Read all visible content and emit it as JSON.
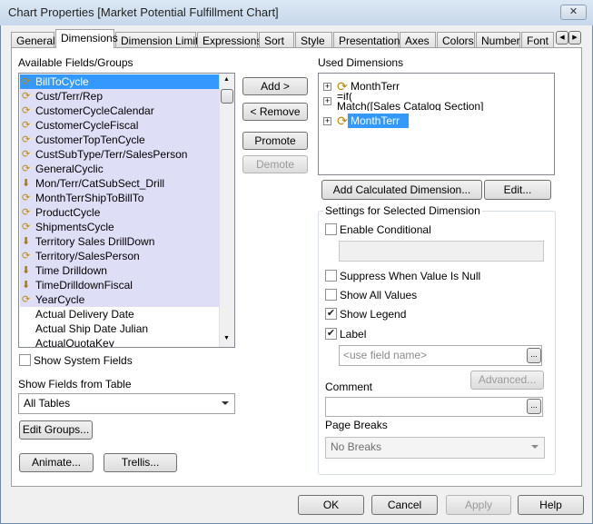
{
  "window": {
    "title": "Chart Properties [Market Potential Fulfillment Chart]",
    "close_icon": "close-icon"
  },
  "tabs": [
    "General",
    "Dimensions",
    "Dimension Limits",
    "Expressions",
    "Sort",
    "Style",
    "Presentation",
    "Axes",
    "Colors",
    "Number",
    "Font"
  ],
  "active_tab": "Dimensions",
  "available": {
    "label": "Available Fields/Groups",
    "items": [
      {
        "label": "BillToCycle",
        "icon": "cyclic-group-icon",
        "selected": true
      },
      {
        "label": "Cust/Terr/Rep",
        "icon": "cyclic-group-icon"
      },
      {
        "label": "CustomerCycleCalendar",
        "icon": "cyclic-group-icon"
      },
      {
        "label": "CustomerCycleFiscal",
        "icon": "cyclic-group-icon"
      },
      {
        "label": "CustomerTopTenCycle",
        "icon": "cyclic-group-icon"
      },
      {
        "label": "CustSubType/Terr/SalesPerson",
        "icon": "cyclic-group-icon"
      },
      {
        "label": "GeneralCyclic",
        "icon": "cyclic-group-icon"
      },
      {
        "label": "Mon/Terr/CatSubSect_Drill",
        "icon": "drilldown-group-icon"
      },
      {
        "label": "MonthTerrShipToBillTo",
        "icon": "cyclic-group-icon"
      },
      {
        "label": "ProductCycle",
        "icon": "cyclic-group-icon"
      },
      {
        "label": "ShipmentsCycle",
        "icon": "cyclic-group-icon"
      },
      {
        "label": "Territory Sales DrillDown",
        "icon": "drilldown-group-icon"
      },
      {
        "label": "Territory/SalesPerson",
        "icon": "cyclic-group-icon"
      },
      {
        "label": "Time Drilldown",
        "icon": "drilldown-group-icon"
      },
      {
        "label": "TimeDrilldownFiscal",
        "icon": "drilldown-group-icon"
      },
      {
        "label": "YearCycle",
        "icon": "cyclic-group-icon"
      },
      {
        "label": "Actual Delivery Date",
        "icon": ""
      },
      {
        "label": "Actual Ship Date Julian",
        "icon": ""
      },
      {
        "label": "ActualQuotaKey",
        "icon": ""
      }
    ]
  },
  "show_system_fields": {
    "label": "Show System Fields",
    "checked": false
  },
  "show_fields_from": {
    "label": "Show Fields from Table",
    "value": "All Tables"
  },
  "buttons": {
    "add": "Add >",
    "remove": "< Remove",
    "promote": "Promote",
    "demote": "Demote",
    "edit_groups": "Edit Groups...",
    "animate": "Animate...",
    "trellis": "Trellis...",
    "add_calc": "Add Calculated Dimension...",
    "edit": "Edit...",
    "advanced": "Advanced...",
    "ok": "OK",
    "cancel": "Cancel",
    "apply": "Apply",
    "help": "Help"
  },
  "used": {
    "label": "Used Dimensions",
    "items": [
      {
        "label": "MonthTerr",
        "line2": "",
        "icon": "cyclic-group-icon"
      },
      {
        "label": "=if(",
        "line2": "Match([Sales Catalog Section]",
        "icon": ""
      },
      {
        "label": "MonthTerr",
        "line2": "",
        "icon": "cyclic-group-icon",
        "selected": true
      }
    ]
  },
  "settings": {
    "title": "Settings for Selected Dimension",
    "enable_conditional": {
      "label": "Enable Conditional",
      "checked": false
    },
    "suppress_null": {
      "label": "Suppress When Value Is Null",
      "checked": false
    },
    "show_all_values": {
      "label": "Show All Values",
      "checked": false
    },
    "show_legend": {
      "label": "Show Legend",
      "checked": true
    },
    "label": {
      "label": "Label",
      "checked": true,
      "placeholder": "<use field name>"
    },
    "comment_label": "Comment",
    "page_breaks": {
      "label": "Page Breaks",
      "value": "No Breaks"
    }
  }
}
